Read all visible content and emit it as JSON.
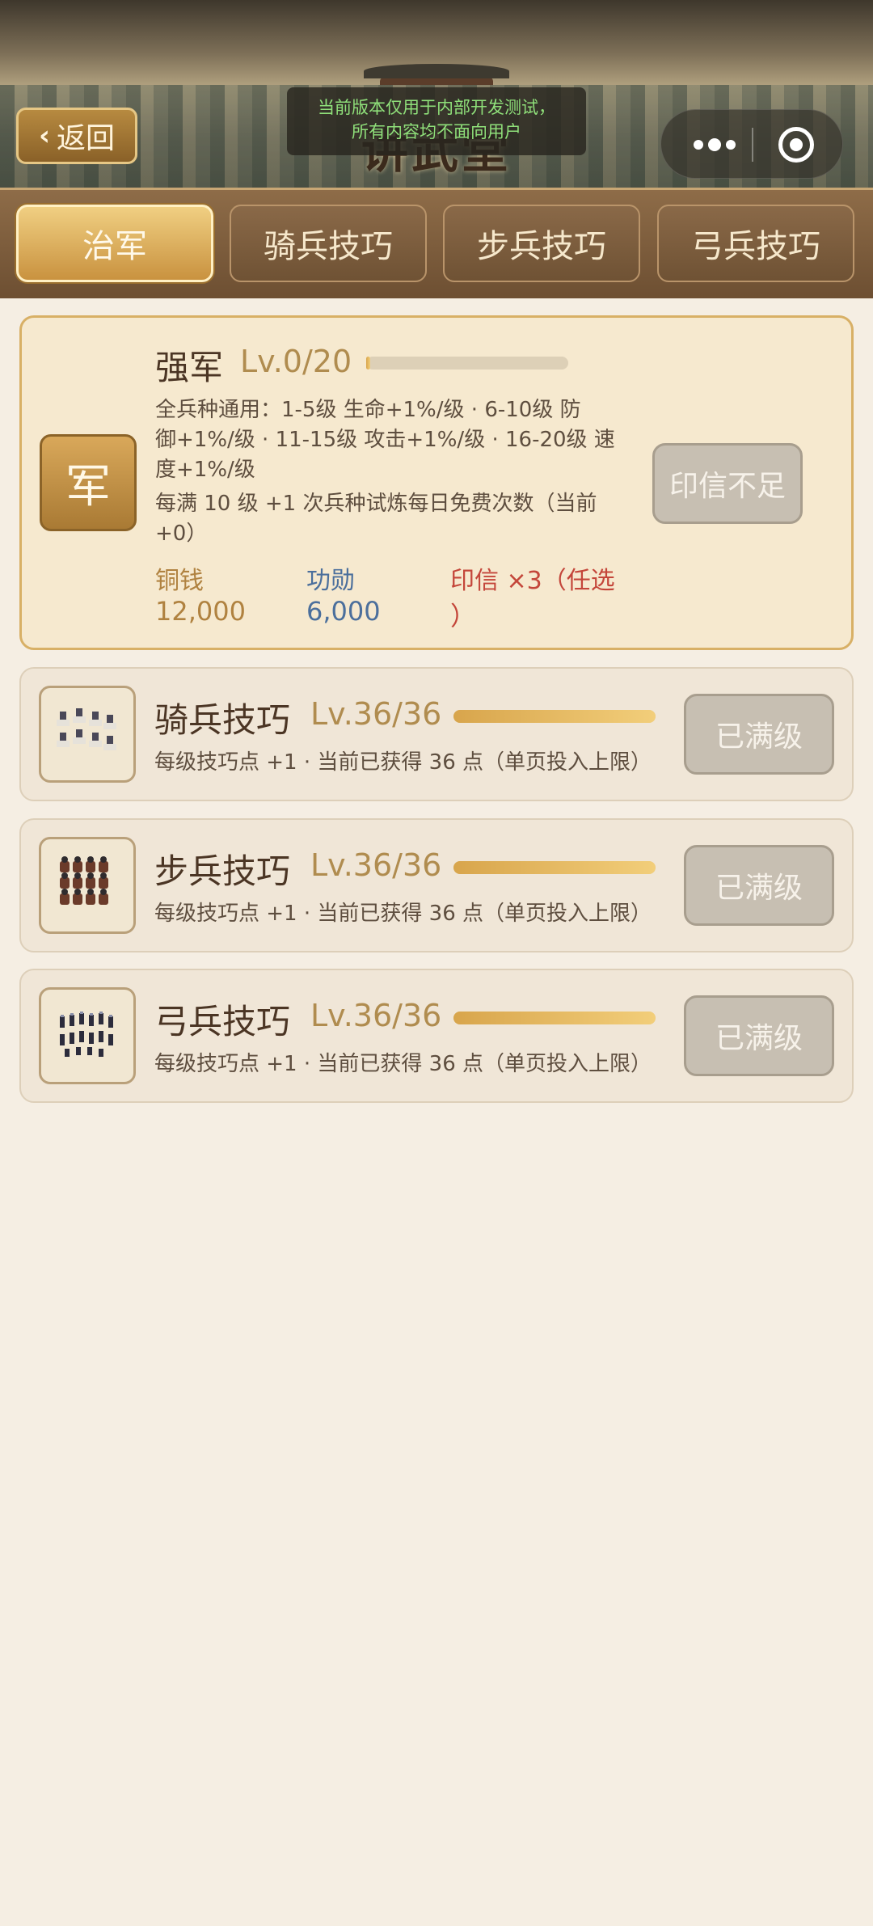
{
  "header": {
    "back_label": "返回",
    "title": "讲武堂",
    "notice_line1": "当前版本仅用于内部开发测试，",
    "notice_line2": "所有内容均不面向用户"
  },
  "tabs": [
    {
      "label": "治军",
      "active": true
    },
    {
      "label": "骑兵技巧",
      "active": false
    },
    {
      "label": "步兵技巧",
      "active": false
    },
    {
      "label": "弓兵技巧",
      "active": false
    }
  ],
  "main_card": {
    "badge": "军",
    "title": "强军",
    "level": "Lv.0/20",
    "progress": 0,
    "desc1": "全兵种通用：1-5级 生命+1%/级 · 6-10级 防",
    "desc2": "御+1%/级 · 11-15级 攻击+1%/级 · 16-20级 速",
    "desc3": "度+1%/级",
    "desc4": "每满 10 级 +1 次兵种试炼每日免费次数（当前",
    "desc5": "+0）",
    "cost_copper_label": "铜钱",
    "cost_copper_value": "12,000",
    "cost_merit_label": "功勋",
    "cost_merit_value": "6,000",
    "cost_seal_line1": "印信 ×3（任选",
    "cost_seal_line2": "）",
    "button": "印信不足"
  },
  "skill_cards": [
    {
      "title": "骑兵技巧",
      "level": "Lv.36/36",
      "progress": 1,
      "desc": "每级技巧点 +1 · 当前已获得 36 点（单页投入上限）",
      "button": "已满级",
      "icon": "cavalry-icon"
    },
    {
      "title": "步兵技巧",
      "level": "Lv.36/36",
      "progress": 1,
      "desc": "每级技巧点 +1 · 当前已获得 36 点（单页投入上限）",
      "button": "已满级",
      "icon": "infantry-icon"
    },
    {
      "title": "弓兵技巧",
      "level": "Lv.36/36",
      "progress": 1,
      "desc": "每级技巧点 +1 · 当前已获得 36 点（单页投入上限）",
      "button": "已满级",
      "icon": "archer-icon"
    }
  ],
  "colors": {
    "accent_gold": "#d8a54c",
    "background": "#f5eee3",
    "warning_red": "#c4463a",
    "merit_blue": "#4b6f9c"
  }
}
